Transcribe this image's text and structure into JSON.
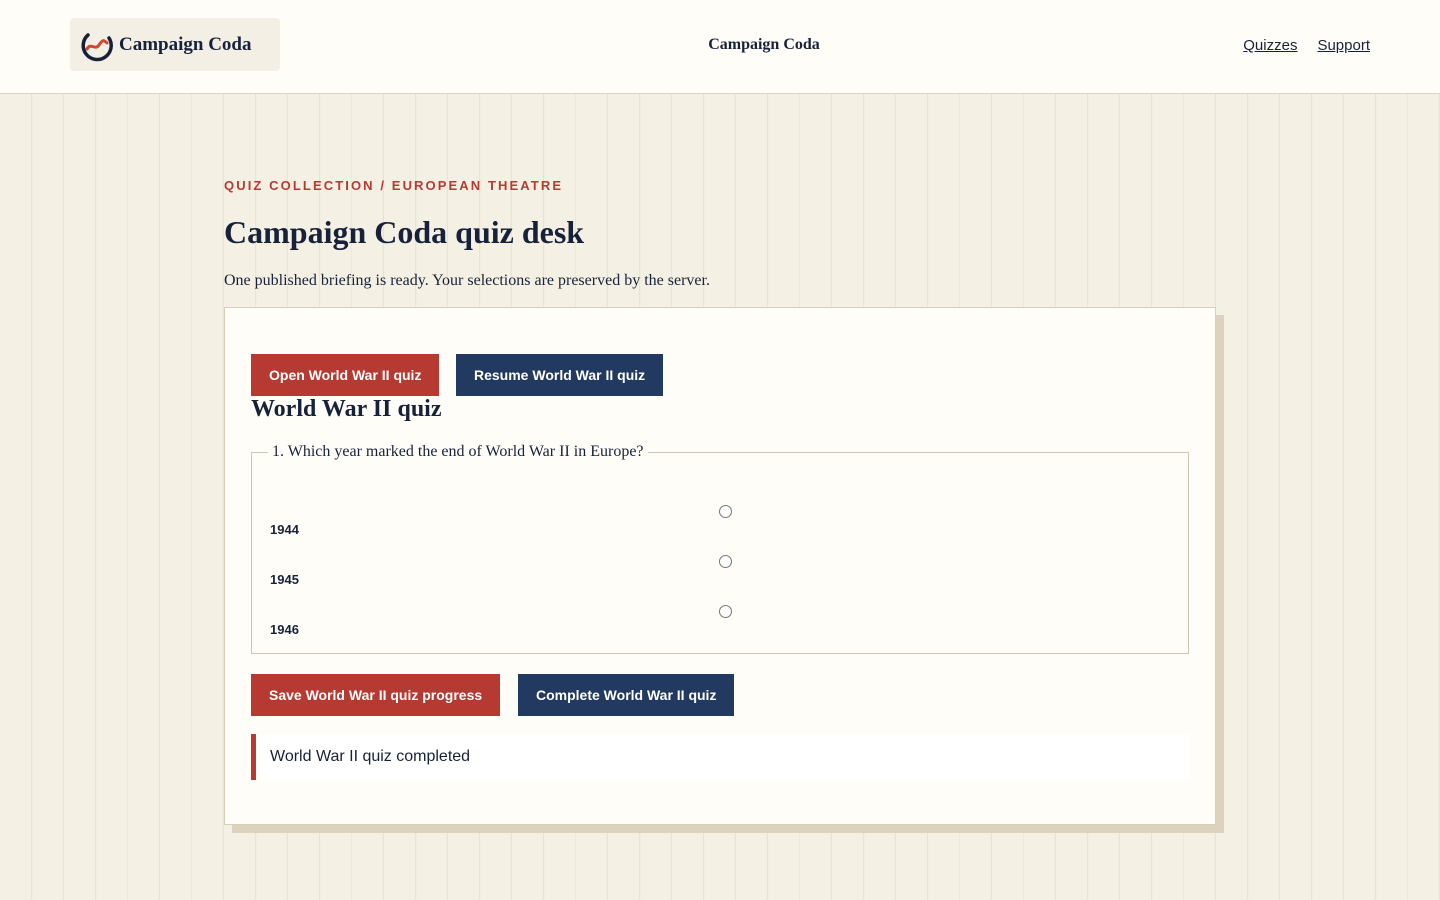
{
  "header": {
    "brand_name": "Campaign Coda",
    "center_title": "Campaign Coda",
    "nav": [
      "Quizzes",
      "Support"
    ]
  },
  "page": {
    "eyebrow": "QUIZ COLLECTION / EUROPEAN THEATRE",
    "title": "Campaign Coda quiz desk",
    "intro": "One published briefing is ready. Your selections are preserved by the server."
  },
  "card": {
    "open_label": "Open World War II quiz",
    "resume_label": "Resume World War II quiz",
    "quiz_title": "World War II quiz",
    "question": "1. Which year marked the end of World War II in Europe?",
    "options": [
      "1944",
      "1945",
      "1946"
    ],
    "save_label": "Save World War II quiz progress",
    "complete_label": "Complete World War II quiz",
    "status": "World War II quiz completed"
  },
  "colors": {
    "accent_red": "#b63a32",
    "navy": "#233a60",
    "text": "#17223a",
    "page_bg": "#f5f0e4"
  }
}
